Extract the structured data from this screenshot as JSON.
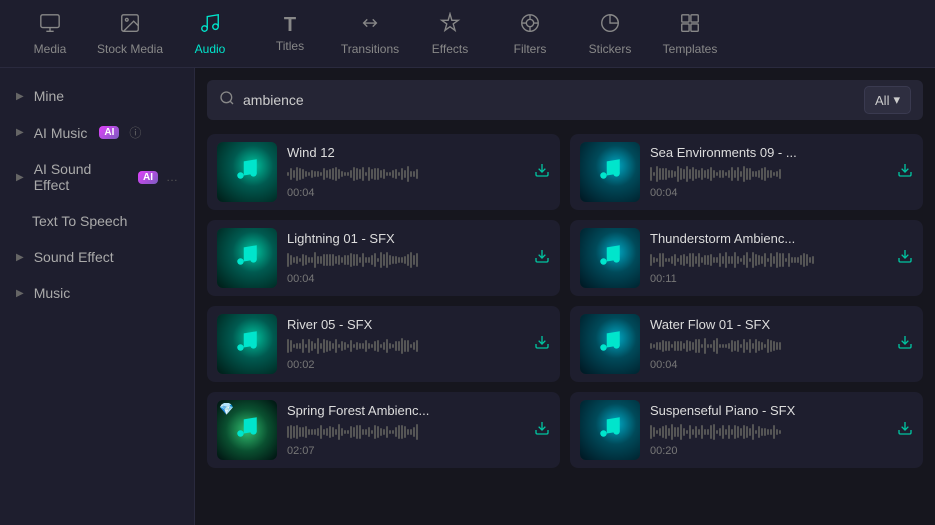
{
  "nav": {
    "items": [
      {
        "id": "media",
        "label": "Media",
        "icon": "🎞",
        "active": false
      },
      {
        "id": "stock-media",
        "label": "Stock Media",
        "icon": "📷",
        "active": false
      },
      {
        "id": "audio",
        "label": "Audio",
        "icon": "🎵",
        "active": true
      },
      {
        "id": "titles",
        "label": "Titles",
        "icon": "T",
        "active": false
      },
      {
        "id": "transitions",
        "label": "Transitions",
        "icon": "↔",
        "active": false
      },
      {
        "id": "effects",
        "label": "Effects",
        "icon": "✦",
        "active": false
      },
      {
        "id": "filters",
        "label": "Filters",
        "icon": "⬡",
        "active": false
      },
      {
        "id": "stickers",
        "label": "Stickers",
        "icon": "⬡",
        "active": false
      },
      {
        "id": "templates",
        "label": "Templates",
        "icon": "⊞",
        "active": false
      }
    ]
  },
  "sidebar": {
    "items": [
      {
        "id": "mine",
        "label": "Mine",
        "hasChevron": true,
        "badge": null,
        "indent": false
      },
      {
        "id": "ai-music",
        "label": "AI Music",
        "hasChevron": true,
        "badge": "AI",
        "indent": false
      },
      {
        "id": "ai-sound-effect",
        "label": "AI Sound Effect",
        "hasChevron": true,
        "badge": "AI",
        "indent": false
      },
      {
        "id": "text-to-speech",
        "label": "Text To Speech",
        "hasChevron": false,
        "badge": null,
        "indent": true
      },
      {
        "id": "sound-effect",
        "label": "Sound Effect",
        "hasChevron": true,
        "badge": null,
        "indent": false
      },
      {
        "id": "music",
        "label": "Music",
        "hasChevron": true,
        "badge": null,
        "indent": false
      }
    ]
  },
  "search": {
    "value": "ambience",
    "placeholder": "ambience",
    "filter_label": "All"
  },
  "cards": [
    {
      "id": "wind-12",
      "title": "Wind 12",
      "duration": "00:04",
      "waveform_style": "normal",
      "thumb_style": "default",
      "has_gem": false
    },
    {
      "id": "sea-environments-09",
      "title": "Sea Environments 09 - ...",
      "duration": "00:04",
      "waveform_style": "normal",
      "thumb_style": "special",
      "has_gem": false
    },
    {
      "id": "lightning-01-sfx",
      "title": "Lightning 01 - SFX",
      "duration": "00:04",
      "waveform_style": "normal",
      "thumb_style": "default",
      "has_gem": false
    },
    {
      "id": "thunderstorm-ambienc",
      "title": "Thunderstorm Ambienc...",
      "duration": "00:11",
      "waveform_style": "dense",
      "thumb_style": "special",
      "has_gem": false
    },
    {
      "id": "river-05-sfx",
      "title": "River 05 - SFX",
      "duration": "00:02",
      "waveform_style": "normal",
      "thumb_style": "default",
      "has_gem": false
    },
    {
      "id": "water-flow-01-sfx",
      "title": "Water Flow 01 - SFX",
      "duration": "00:04",
      "waveform_style": "normal",
      "thumb_style": "special",
      "has_gem": false
    },
    {
      "id": "spring-forest-ambienc",
      "title": "Spring Forest Ambienc...",
      "duration": "02:07",
      "waveform_style": "normal",
      "thumb_style": "green",
      "has_gem": true
    },
    {
      "id": "suspenseful-piano-sfx",
      "title": "Suspenseful Piano - SFX",
      "duration": "00:20",
      "waveform_style": "normal",
      "thumb_style": "special",
      "has_gem": false
    }
  ],
  "icons": {
    "chevron_right": "▶",
    "chevron_down": "▼",
    "search": "🔍",
    "download": "⬇",
    "music_note": "♪",
    "gem": "💎",
    "ai_badge": "AI",
    "filter_chevron": "▾"
  }
}
